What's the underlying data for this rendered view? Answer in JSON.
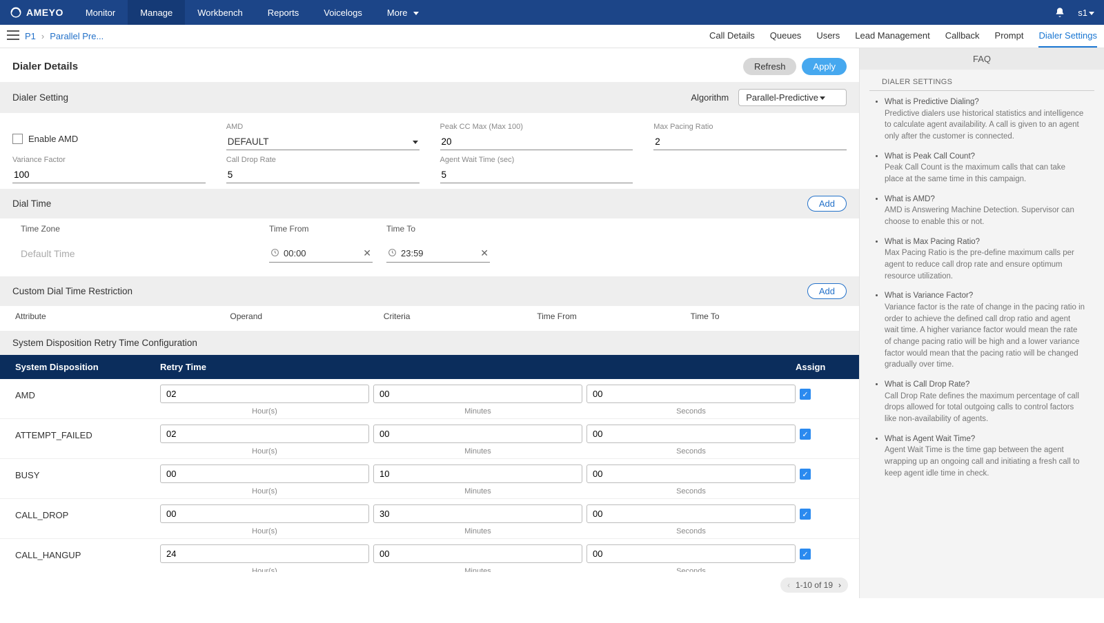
{
  "topnav": {
    "brand": "AMEYO",
    "items": [
      "Monitor",
      "Manage",
      "Workbench",
      "Reports",
      "Voicelogs",
      "More"
    ],
    "active": 1,
    "user": "s1"
  },
  "breadcrumb": {
    "p1": "P1",
    "p2": "Parallel Pre..."
  },
  "subtabs": [
    "Call Details",
    "Queues",
    "Users",
    "Lead Management",
    "Callback",
    "Prompt",
    "Dialer Settings"
  ],
  "subtabActive": 6,
  "header": {
    "title": "Dialer Details",
    "refresh": "Refresh",
    "apply": "Apply"
  },
  "dialerSetting": {
    "title": "Dialer Setting",
    "algoLabel": "Algorithm",
    "algoValue": "Parallel-Predictive",
    "enableAMD": "Enable AMD",
    "fields": {
      "amd": {
        "label": "AMD",
        "value": "DEFAULT"
      },
      "peakCC": {
        "label": "Peak CC Max (Max 100)",
        "value": "20"
      },
      "maxPacing": {
        "label": "Max Pacing Ratio",
        "value": "2"
      },
      "variance": {
        "label": "Variance Factor",
        "value": "100"
      },
      "callDrop": {
        "label": "Call Drop Rate",
        "value": "5"
      },
      "agentWait": {
        "label": "Agent Wait Time (sec)",
        "value": "5"
      }
    }
  },
  "dialTime": {
    "title": "Dial Time",
    "add": "Add",
    "cols": {
      "tz": "Time Zone",
      "from": "Time From",
      "to": "Time To"
    },
    "defaultLabel": "Default Time",
    "from": "00:00",
    "to": "23:59"
  },
  "customRestrict": {
    "title": "Custom Dial Time Restriction",
    "add": "Add",
    "cols": [
      "Attribute",
      "Operand",
      "Criteria",
      "Time From",
      "Time To"
    ]
  },
  "retry": {
    "title": "System Disposition Retry Time Configuration",
    "headers": {
      "disp": "System Disposition",
      "time": "Retry Time",
      "assign": "Assign"
    },
    "sub": {
      "hours": "Hour(s)",
      "minutes": "Minutes",
      "seconds": "Seconds"
    },
    "rows": [
      {
        "disp": "AMD",
        "h": "02",
        "m": "00",
        "s": "00",
        "assign": true
      },
      {
        "disp": "ATTEMPT_FAILED",
        "h": "02",
        "m": "00",
        "s": "00",
        "assign": true
      },
      {
        "disp": "BUSY",
        "h": "00",
        "m": "10",
        "s": "00",
        "assign": true
      },
      {
        "disp": "CALL_DROP",
        "h": "00",
        "m": "30",
        "s": "00",
        "assign": true
      },
      {
        "disp": "CALL_HANGUP",
        "h": "24",
        "m": "00",
        "s": "00",
        "assign": true
      }
    ],
    "pager": "1-10 of 19"
  },
  "faq": {
    "title": "FAQ",
    "section": "DIALER SETTINGS",
    "items": [
      {
        "q": "What is Predictive Dialing?",
        "a": "Predictive dialers use historical statistics and intelligence to calculate agent availability. A call is given to an agent only after the customer is connected."
      },
      {
        "q": "What is Peak Call Count?",
        "a": "Peak Call Count is the maximum calls that can take place at the same time in this campaign."
      },
      {
        "q": "What is AMD?",
        "a": "AMD is Answering Machine Detection. Supervisor can choose to enable this or not."
      },
      {
        "q": "What is Max Pacing Ratio?",
        "a": "Max Pacing Ratio is the pre-define maximum calls per agent to reduce call drop rate and ensure optimum resource utilization."
      },
      {
        "q": "What is Variance Factor?",
        "a": "Variance factor is the rate of change in the pacing ratio in order to achieve the defined call drop ratio and agent wait time. A higher variance factor would mean the rate of change pacing ratio will be high and a lower variance factor would mean that the pacing ratio will be changed gradually over time."
      },
      {
        "q": "What is Call Drop Rate?",
        "a": "Call Drop Rate defines the maximum percentage of call drops allowed for total outgoing calls to control factors like non-availability of agents."
      },
      {
        "q": "What is Agent Wait Time?",
        "a": "Agent Wait Time is the time gap between the agent wrapping up an ongoing call and initiating a fresh call to keep agent idle time in check."
      }
    ]
  }
}
